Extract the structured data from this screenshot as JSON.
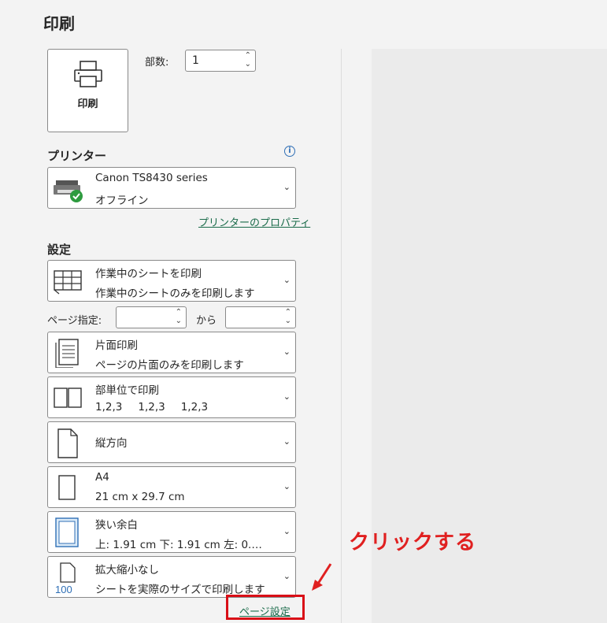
{
  "page_title": "印刷",
  "print_button": {
    "label": "印刷",
    "icon": "printer-icon"
  },
  "copies": {
    "label": "部数:",
    "value": "1"
  },
  "printer": {
    "section_title": "プリンター",
    "name": "Canon TS8430 series",
    "status": "オフライン",
    "properties_link": "プリンターのプロパティ"
  },
  "settings": {
    "section_title": "設定",
    "print_what": {
      "title": "作業中のシートを印刷",
      "sub": "作業中のシートのみを印刷します"
    },
    "pages": {
      "label": "ページ指定:",
      "from_value": "",
      "to_label": "から",
      "to_value": ""
    },
    "sides": {
      "title": "片面印刷",
      "sub": "ページの片面のみを印刷します"
    },
    "collation": {
      "title": "部単位で印刷",
      "sub": [
        "1,2,3",
        "1,2,3",
        "1,2,3"
      ]
    },
    "orientation": {
      "title": "縦方向"
    },
    "paper": {
      "title": "A4",
      "sub": "21 cm x 29.7 cm"
    },
    "margins": {
      "title": "狭い余白",
      "sub": "上: 1.91 cm 下: 1.91 cm 左: 0.…"
    },
    "scaling": {
      "title": "拡大縮小なし",
      "sub": "シートを実際のサイズで印刷します",
      "icon_text": "100"
    },
    "page_setup_link": "ページ設定"
  },
  "annotation": {
    "text": "クリックする",
    "color": "#e02020"
  },
  "colors": {
    "link": "#1a6b4a",
    "highlight": "#d90f17",
    "background": "#f3f3f3"
  }
}
